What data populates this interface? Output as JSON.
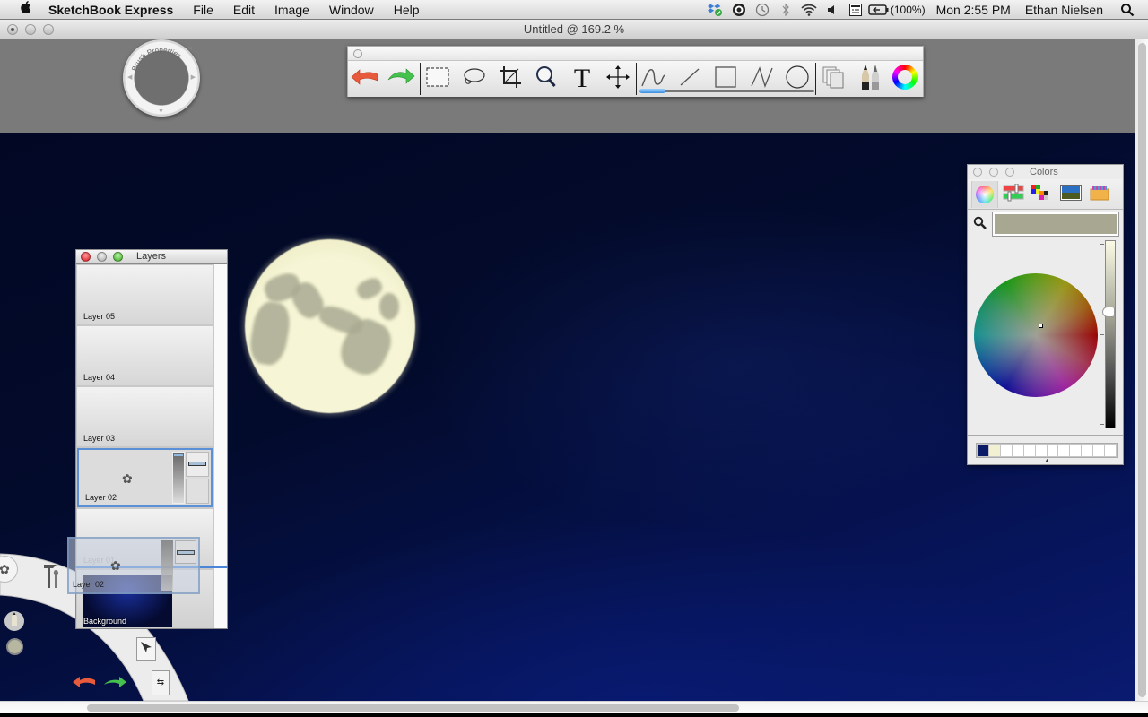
{
  "menubar": {
    "apple_icon": "apple-logo-icon",
    "app_name": "SketchBook Express",
    "menus": [
      "File",
      "Edit",
      "Image",
      "Window",
      "Help"
    ],
    "status_icons": [
      "dropbox-icon",
      "app-status-icon",
      "time-machine-icon",
      "bluetooth-icon",
      "wifi-icon",
      "volume-icon",
      "keyboard-viewer-icon",
      "battery-icon"
    ],
    "battery": "(100%)",
    "clock": "Mon 2:55 PM",
    "user": "Ethan Nielsen",
    "spotlight_icon": "spotlight-search-icon"
  },
  "window": {
    "title": "Untitled @ 169.2 %"
  },
  "brush_properties": {
    "label": "Brush Properties"
  },
  "toolbar": {
    "tools": [
      {
        "name": "undo",
        "icon": "undo-arrow-icon"
      },
      {
        "name": "redo",
        "icon": "redo-arrow-icon"
      },
      {
        "name": "rectangle-select",
        "icon": "rect-select-icon"
      },
      {
        "name": "lasso",
        "icon": "lasso-icon"
      },
      {
        "name": "crop",
        "icon": "crop-icon"
      },
      {
        "name": "zoom",
        "icon": "magnifier-icon"
      },
      {
        "name": "text",
        "icon": "text-icon",
        "glyph": "T"
      },
      {
        "name": "move",
        "icon": "move-icon"
      },
      {
        "name": "freehand-stroke",
        "icon": "freehand-icon"
      },
      {
        "name": "line",
        "icon": "line-icon"
      },
      {
        "name": "rectangle",
        "icon": "rectangle-icon"
      },
      {
        "name": "polyline",
        "icon": "polyline-icon"
      },
      {
        "name": "ellipse",
        "icon": "ellipse-icon"
      },
      {
        "name": "layers",
        "icon": "layers-icon"
      },
      {
        "name": "brushes",
        "icon": "brushes-icon"
      },
      {
        "name": "colors",
        "icon": "color-wheel-icon"
      }
    ],
    "stroke_level": 0.15
  },
  "layers_panel": {
    "title": "Layers",
    "layers": [
      {
        "name": "Layer 05",
        "selected": false
      },
      {
        "name": "Layer 04",
        "selected": false
      },
      {
        "name": "Layer 03",
        "selected": false
      },
      {
        "name": "Layer 02",
        "selected": true
      },
      {
        "name": "Layer 01",
        "selected": false
      },
      {
        "name": "Background",
        "selected": false
      }
    ],
    "drag_ghost_label": "Layer 02"
  },
  "colors_panel": {
    "title": "Colors",
    "modes": [
      "color-wheel-mode-icon",
      "color-sliders-mode-icon",
      "color-palettes-mode-icon",
      "image-palettes-mode-icon",
      "crayons-mode-icon"
    ],
    "current_color": "#a8a792",
    "brightness": 0.62,
    "favorites": [
      "#0b1a66",
      "#f2f0d2",
      "#ffffff",
      "#ffffff",
      "#ffffff",
      "#ffffff",
      "#ffffff",
      "#ffffff",
      "#ffffff",
      "#ffffff",
      "#ffffff",
      "#ffffff"
    ]
  },
  "canvas": {
    "background_color": "#030b2c",
    "moon_color": "#f4f3d0",
    "crater_color": "#a9aa92"
  },
  "lagoon": {
    "items": [
      "brush-icon",
      "tools-icon",
      "pencil-icon",
      "color-puck-icon",
      "select-tool-icon",
      "undo-arrow-icon",
      "redo-arrow-icon",
      "layer-swap-icon"
    ]
  }
}
